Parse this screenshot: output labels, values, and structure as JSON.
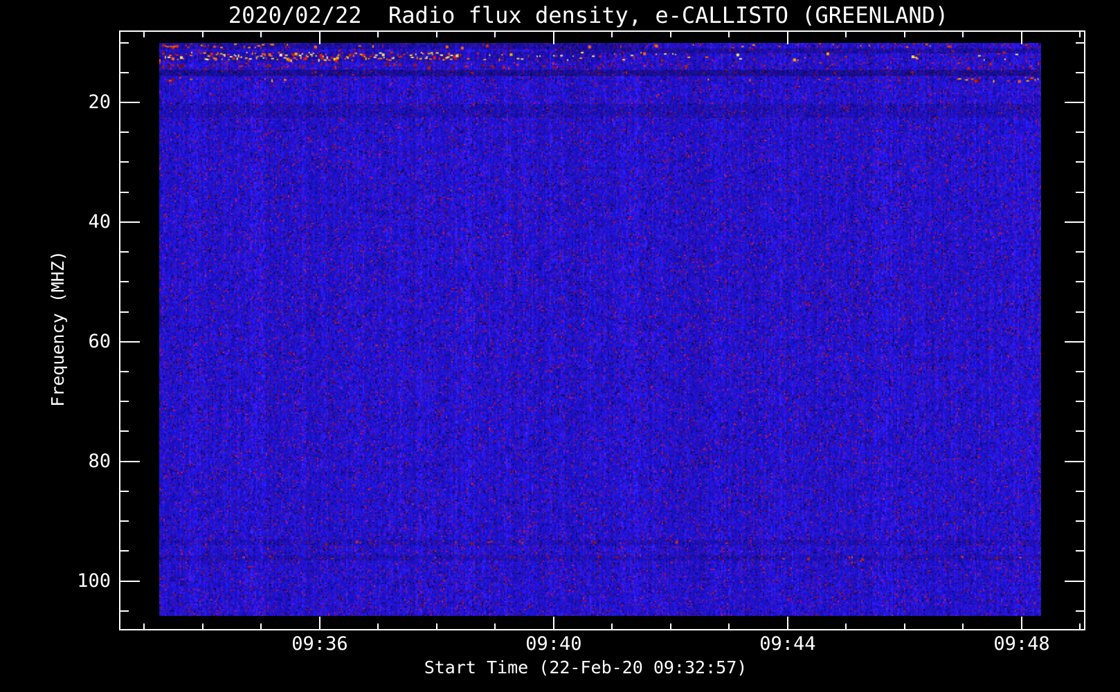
{
  "window": {
    "background": "#000000",
    "text_color": "#ffffff",
    "frame_color": "#ffffff"
  },
  "chart": {
    "title": "2020/02/22  Radio flux density, e-CALLISTO (GREENLAND)",
    "x_axis": {
      "label": "Start Time (22-Feb-20 09:32:57)",
      "major_ticks": [
        {
          "label": "09:36",
          "frac": 0.2077
        },
        {
          "label": "09:40",
          "frac": 0.4498
        },
        {
          "label": "09:44",
          "frac": 0.6919
        },
        {
          "label": "09:48",
          "frac": 0.9341
        }
      ],
      "minor_step_frac": 0.060525,
      "minor_k_range": [
        -3,
        13
      ]
    },
    "y_axis": {
      "label": "Frequency (MHZ)",
      "major_ticks": [
        {
          "label": "20",
          "frac": 0.1199
        },
        {
          "label": "40",
          "frac": 0.3193
        },
        {
          "label": "60",
          "frac": 0.5188
        },
        {
          "label": "80",
          "frac": 0.7182
        },
        {
          "label": "100",
          "frac": 0.9176
        }
      ],
      "minor_step_frac": 0.049855,
      "minor_k_range": [
        -2,
        17
      ]
    }
  },
  "chart_data": {
    "type": "heatmap",
    "subtype": "radio-spectrogram",
    "title": "2020/02/22  Radio flux density, e-CALLISTO (GREENLAND)",
    "date": "2020/02/22",
    "instrument": "e-CALLISTO",
    "station": "GREENLAND",
    "xlabel": "Start Time (22-Feb-20 09:32:57)",
    "ylabel": "Frequency (MHZ)",
    "start_time": "22-Feb-20 09:32:57",
    "x_major_tick_labels": [
      "09:36",
      "09:40",
      "09:44",
      "09:48"
    ],
    "x_minor_tick_interval_minutes": 1,
    "y_major_tick_labels": [
      20,
      40,
      60,
      80,
      100
    ],
    "y_minor_tick_interval_mhz": 5,
    "y_axis_direction": "frequency increases downward",
    "freq_axis_range_mhz_est": [
      8,
      108
    ],
    "data_freq_range_mhz_est": [
      10,
      106
    ],
    "data_time_end_est": "09:48:20",
    "legend": "none",
    "grid": "off",
    "colormap": {
      "background_blue": "#2828e0",
      "bright_blue": "#4040ff",
      "noise_purple": "#5a1a9a",
      "noise_maroon": "#7a1040",
      "rfi_yellow": "#ffe24a",
      "rfi_orange": "#ff7800",
      "rfi_red": "#e02000"
    },
    "features_described": [
      {
        "name": "sparse orange RFI dashes",
        "freq_mhz": [
          10.2,
          11.0
        ],
        "time": "mostly 09:33-09:36, sporadic after"
      },
      {
        "name": "strong RFI band (yellow/orange/red, nearly continuous)",
        "freq_mhz": [
          11.7,
          13.2
        ],
        "time": "bright 09:33-09:38, fading to red speckles until ~09:44"
      },
      {
        "name": "red speckle band below strong RFI",
        "freq_mhz": [
          13.2,
          14.5
        ],
        "time": "09:33-09:40"
      },
      {
        "name": "dark horizontal lane",
        "freq_mhz": [
          14.5,
          15.5
        ],
        "time": "full span"
      },
      {
        "name": "red dashed RFI line",
        "freq_mhz": [
          15.7,
          16.5
        ],
        "time": "strongest 09:46-09:48, also near start"
      },
      {
        "name": "faint dark/red speckle line",
        "freq_mhz": [
          93,
          94
        ],
        "time": "left half"
      },
      {
        "name": "faint dark/red speckle line",
        "freq_mhz": [
          96,
          97
        ],
        "time": "full span"
      },
      {
        "name": "blue noise body with purple/maroon speckles and vertical striations",
        "freq_mhz": [
          10,
          106
        ],
        "time": "full span"
      }
    ],
    "render": {
      "seed": 20200222,
      "cell": 2,
      "noise": {
        "purple_p": 0.06,
        "maroon_p": 0.025,
        "dark_p": 0.05,
        "red_dot_p": 0.0045
      },
      "features": [
        {
          "name": "top-dash-row",
          "rows": [
            0,
            9
          ],
          "dim": 0.22,
          "dim_x": [
            0,
            0.55
          ],
          "segments": [
            {
              "x": [
                0,
                0.16
              ],
              "density": 0.3
            },
            {
              "x": [
                0.16,
                0.55
              ],
              "density": 0.05
            },
            {
              "x": [
                0.55,
                1.0
              ],
              "density": 0.09
            }
          ],
          "colors": [
            "#ff6a00",
            "#e03000",
            "#ff9400",
            "#a82020"
          ]
        },
        {
          "name": "top-dark-right",
          "rows": [
            8,
            15
          ],
          "dim": 0.22,
          "dim_x": [
            0.45,
            1.0
          ],
          "segments": [],
          "colors": []
        },
        {
          "name": "strong-rfi-band",
          "rows": [
            13,
            27
          ],
          "dim": 0.12,
          "dim_x": [
            0,
            0.5
          ],
          "segments": [
            {
              "x": [
                0,
                0.05
              ],
              "density": 0.55
            },
            {
              "x": [
                0.05,
                0.33
              ],
              "density": 0.8
            },
            {
              "x": [
                0.33,
                0.42
              ],
              "density": 0.35
            },
            {
              "x": [
                0.42,
                0.62
              ],
              "density": 0.15
            },
            {
              "x": [
                0.62,
                0.85
              ],
              "density": 0.07
            },
            {
              "x": [
                0.85,
                1.0
              ],
              "density": 0.12
            }
          ],
          "colors": [
            "#ffe24a",
            "#ffb000",
            "#ff6a00",
            "#e82000",
            "#fff1a0",
            "#c03000"
          ]
        },
        {
          "name": "under-band-speckle",
          "rows": [
            27,
            39
          ],
          "dim": 0,
          "dim_x": [
            0,
            1
          ],
          "segments": [
            {
              "x": [
                0,
                0.45
              ],
              "density": 0.22
            },
            {
              "x": [
                0.45,
                1.0
              ],
              "density": 0.1
            }
          ],
          "colors": [
            "#a01818",
            "#c22000",
            "#6a1010",
            "#e03020"
          ]
        },
        {
          "name": "dark-lane-15mhz",
          "rows": [
            39,
            48
          ],
          "dim": 0.3,
          "dim_x": [
            0,
            1
          ],
          "segments": [
            {
              "x": [
                0,
                1.0
              ],
              "density": 0.04
            }
          ],
          "colors": [
            "#8a1515",
            "#b02020"
          ]
        },
        {
          "name": "rfi-line-16mhz",
          "rows": [
            49,
            57
          ],
          "dim": 0,
          "dim_x": [
            0,
            1
          ],
          "segments": [
            {
              "x": [
                0,
                0.15
              ],
              "density": 0.13
            },
            {
              "x": [
                0.6,
                0.9
              ],
              "density": 0.07
            },
            {
              "x": [
                0.9,
                1.0
              ],
              "density": 0.3
            }
          ],
          "colors": [
            "#e03000",
            "#ff5a00",
            "#8a1010",
            "#ffb000"
          ]
        },
        {
          "name": "dark-lane-20mhz",
          "rows": [
            88,
            108
          ],
          "dim": 0.12,
          "dim_x": [
            0,
            1
          ],
          "segments": [],
          "colors": []
        },
        {
          "name": "faint-line-93mhz",
          "rows": [
            718,
            726
          ],
          "dim": 0.1,
          "dim_x": [
            0,
            1
          ],
          "segments": [
            {
              "x": [
                0.05,
                0.65
              ],
              "density": 0.05
            }
          ],
          "colors": [
            "#8a1818",
            "#c03030"
          ]
        },
        {
          "name": "faint-line-96mhz",
          "rows": [
            740,
            748
          ],
          "dim": 0.12,
          "dim_x": [
            0,
            1
          ],
          "segments": [
            {
              "x": [
                0,
                1.0
              ],
              "density": 0.05
            }
          ],
          "colors": [
            "#8a1515",
            "#a82525",
            "#d04040"
          ]
        }
      ]
    }
  }
}
